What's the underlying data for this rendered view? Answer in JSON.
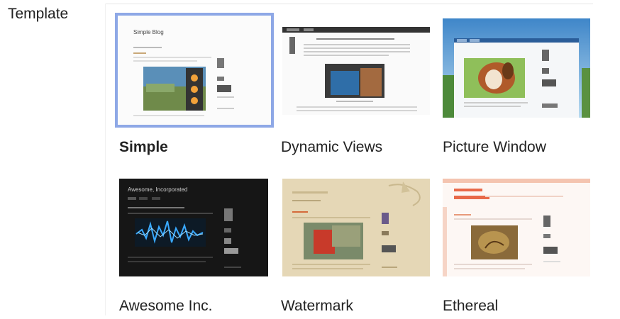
{
  "section": {
    "label": "Template"
  },
  "templates": [
    {
      "name": "Simple",
      "selected": true,
      "thumb_title": "Simple Blog"
    },
    {
      "name": "Dynamic Views",
      "selected": false
    },
    {
      "name": "Picture Window",
      "selected": false
    },
    {
      "name": "Awesome Inc.",
      "selected": false,
      "thumb_title": "Awesome, Incorporated"
    },
    {
      "name": "Watermark",
      "selected": false
    },
    {
      "name": "Ethereal",
      "selected": false
    }
  ],
  "colors": {
    "selection_outline": "#8ea8e6",
    "awesome_bg": "#1b1b1b",
    "watermark_bg": "#e8dcc0",
    "ethereal_accent": "#e86a4a"
  }
}
